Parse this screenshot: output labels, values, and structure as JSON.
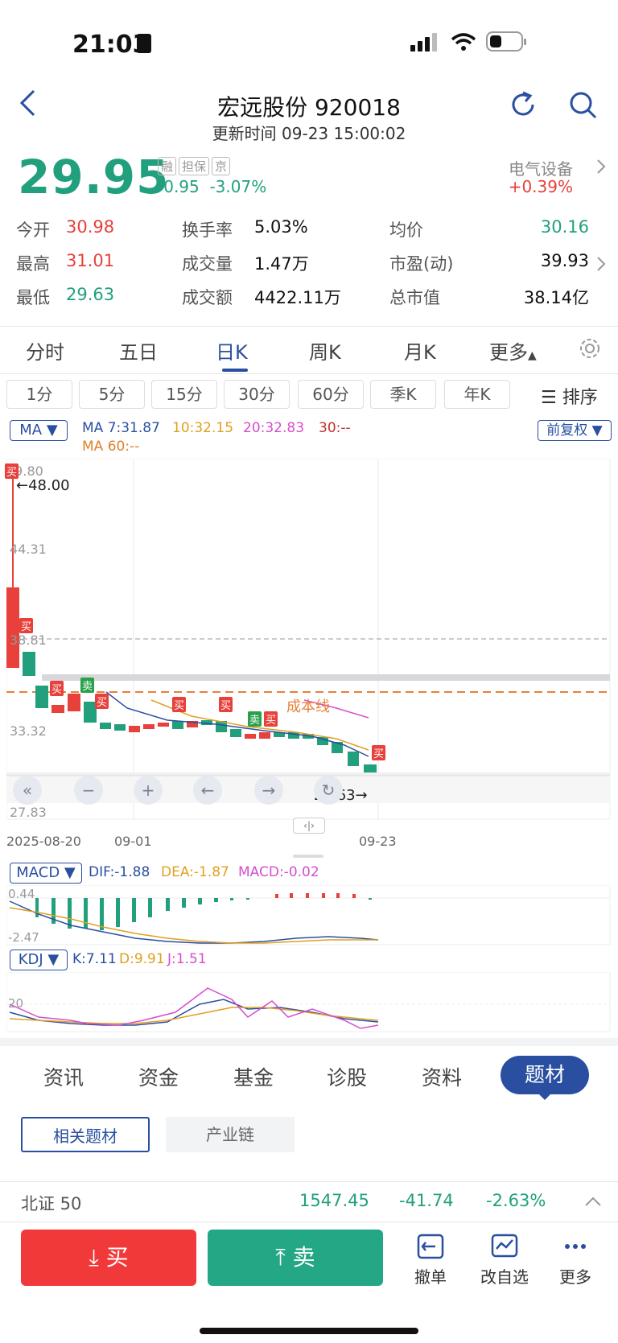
{
  "status_bar": {
    "time": "21:03"
  },
  "header": {
    "title": "宏远股份 920018",
    "subtitle": "更新时间 09-23 15:00:02",
    "price": "29.95",
    "tags": [
      "融",
      "担保",
      "京"
    ],
    "change": "-0.95  -3.07%",
    "sector": "电气设备",
    "sector_change": "+0.39%"
  },
  "stats": [
    {
      "label": "今开",
      "value": "30.98",
      "color": "#e8403a"
    },
    {
      "label": "最高",
      "value": "31.01",
      "color": "#e8403a"
    },
    {
      "label": "最低",
      "value": "29.63",
      "color": "#22a07e"
    },
    {
      "label": "换手率",
      "value": "5.03%",
      "color": "#111111"
    },
    {
      "label": "成交量",
      "value": "1.47万",
      "color": "#111111"
    },
    {
      "label": "成交额",
      "value": "4422.11万",
      "color": "#111111"
    },
    {
      "label": "均价",
      "value": "30.16",
      "color": "#22a07e"
    },
    {
      "label": "市盈(动)",
      "value": "39.93",
      "color": "#111111"
    },
    {
      "label": "总市值",
      "value": "38.14亿",
      "color": "#111111"
    }
  ],
  "period_tabs": [
    "分时",
    "五日",
    "日K",
    "周K",
    "月K",
    "更多"
  ],
  "intervals": [
    "1分",
    "5分",
    "15分",
    "30分",
    "60分",
    "季K",
    "年K"
  ],
  "sort_label": "排序",
  "ma": {
    "selector": "MA",
    "ma7": "MA 7:31.87",
    "ma10": "10:32.15",
    "ma20": "20:32.83",
    "ma30": "30:--",
    "ma60": "MA 60:--",
    "adjust": "前复权"
  },
  "chart_labels": {
    "y_top": "49.80",
    "y_2": "44.31",
    "y_3": "38.81",
    "y_4": "33.32",
    "y_5": "27.83",
    "high_marker": "←48.00",
    "low_marker": "29.63→",
    "cost_line": "成本线",
    "date_start": "2025-08-20",
    "date_mid": "09-01",
    "date_end": "09-23",
    "buy": "买",
    "sell": "卖"
  },
  "macd": {
    "selector": "MACD",
    "dif": "DIF:-1.88",
    "dea": "DEA:-1.87",
    "macd": "MACD:-0.02",
    "y_top": "0.44",
    "y_bottom": "-2.47"
  },
  "kdj": {
    "selector": "KDJ",
    "k": "K:7.11",
    "d": "D:9.91",
    "j": "J:1.51",
    "y_mark": "20"
  },
  "bottom_tabs": [
    "资讯",
    "资金",
    "基金",
    "诊股",
    "资料",
    "题材"
  ],
  "sub_tabs": [
    "相关题材",
    "产业链"
  ],
  "index": {
    "name": "北证 50",
    "value": "1547.45",
    "change": "-41.74",
    "pct": "-2.63%"
  },
  "actions": {
    "buy": "买",
    "sell": "卖",
    "cancel": "撤单",
    "edit_watch": "改自选",
    "more": "更多"
  },
  "colors": {
    "up": "#e8403a",
    "down": "#22a07e",
    "accent": "#2a4fa0"
  }
}
